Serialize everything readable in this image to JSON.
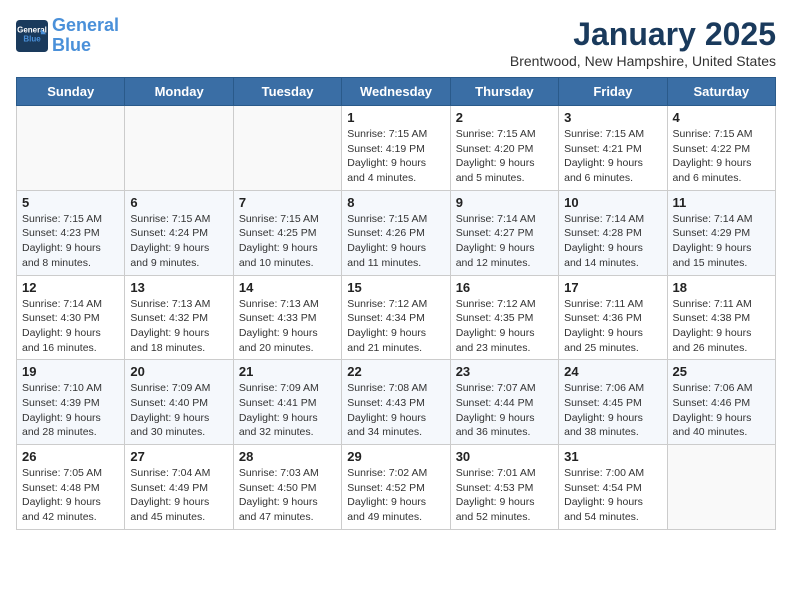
{
  "header": {
    "logo_line1": "General",
    "logo_line2": "Blue",
    "month": "January 2025",
    "location": "Brentwood, New Hampshire, United States"
  },
  "weekdays": [
    "Sunday",
    "Monday",
    "Tuesday",
    "Wednesday",
    "Thursday",
    "Friday",
    "Saturday"
  ],
  "weeks": [
    [
      {
        "day": "",
        "info": ""
      },
      {
        "day": "",
        "info": ""
      },
      {
        "day": "",
        "info": ""
      },
      {
        "day": "1",
        "info": "Sunrise: 7:15 AM\nSunset: 4:19 PM\nDaylight: 9 hours and 4 minutes."
      },
      {
        "day": "2",
        "info": "Sunrise: 7:15 AM\nSunset: 4:20 PM\nDaylight: 9 hours and 5 minutes."
      },
      {
        "day": "3",
        "info": "Sunrise: 7:15 AM\nSunset: 4:21 PM\nDaylight: 9 hours and 6 minutes."
      },
      {
        "day": "4",
        "info": "Sunrise: 7:15 AM\nSunset: 4:22 PM\nDaylight: 9 hours and 6 minutes."
      }
    ],
    [
      {
        "day": "5",
        "info": "Sunrise: 7:15 AM\nSunset: 4:23 PM\nDaylight: 9 hours and 8 minutes."
      },
      {
        "day": "6",
        "info": "Sunrise: 7:15 AM\nSunset: 4:24 PM\nDaylight: 9 hours and 9 minutes."
      },
      {
        "day": "7",
        "info": "Sunrise: 7:15 AM\nSunset: 4:25 PM\nDaylight: 9 hours and 10 minutes."
      },
      {
        "day": "8",
        "info": "Sunrise: 7:15 AM\nSunset: 4:26 PM\nDaylight: 9 hours and 11 minutes."
      },
      {
        "day": "9",
        "info": "Sunrise: 7:14 AM\nSunset: 4:27 PM\nDaylight: 9 hours and 12 minutes."
      },
      {
        "day": "10",
        "info": "Sunrise: 7:14 AM\nSunset: 4:28 PM\nDaylight: 9 hours and 14 minutes."
      },
      {
        "day": "11",
        "info": "Sunrise: 7:14 AM\nSunset: 4:29 PM\nDaylight: 9 hours and 15 minutes."
      }
    ],
    [
      {
        "day": "12",
        "info": "Sunrise: 7:14 AM\nSunset: 4:30 PM\nDaylight: 9 hours and 16 minutes."
      },
      {
        "day": "13",
        "info": "Sunrise: 7:13 AM\nSunset: 4:32 PM\nDaylight: 9 hours and 18 minutes."
      },
      {
        "day": "14",
        "info": "Sunrise: 7:13 AM\nSunset: 4:33 PM\nDaylight: 9 hours and 20 minutes."
      },
      {
        "day": "15",
        "info": "Sunrise: 7:12 AM\nSunset: 4:34 PM\nDaylight: 9 hours and 21 minutes."
      },
      {
        "day": "16",
        "info": "Sunrise: 7:12 AM\nSunset: 4:35 PM\nDaylight: 9 hours and 23 minutes."
      },
      {
        "day": "17",
        "info": "Sunrise: 7:11 AM\nSunset: 4:36 PM\nDaylight: 9 hours and 25 minutes."
      },
      {
        "day": "18",
        "info": "Sunrise: 7:11 AM\nSunset: 4:38 PM\nDaylight: 9 hours and 26 minutes."
      }
    ],
    [
      {
        "day": "19",
        "info": "Sunrise: 7:10 AM\nSunset: 4:39 PM\nDaylight: 9 hours and 28 minutes."
      },
      {
        "day": "20",
        "info": "Sunrise: 7:09 AM\nSunset: 4:40 PM\nDaylight: 9 hours and 30 minutes."
      },
      {
        "day": "21",
        "info": "Sunrise: 7:09 AM\nSunset: 4:41 PM\nDaylight: 9 hours and 32 minutes."
      },
      {
        "day": "22",
        "info": "Sunrise: 7:08 AM\nSunset: 4:43 PM\nDaylight: 9 hours and 34 minutes."
      },
      {
        "day": "23",
        "info": "Sunrise: 7:07 AM\nSunset: 4:44 PM\nDaylight: 9 hours and 36 minutes."
      },
      {
        "day": "24",
        "info": "Sunrise: 7:06 AM\nSunset: 4:45 PM\nDaylight: 9 hours and 38 minutes."
      },
      {
        "day": "25",
        "info": "Sunrise: 7:06 AM\nSunset: 4:46 PM\nDaylight: 9 hours and 40 minutes."
      }
    ],
    [
      {
        "day": "26",
        "info": "Sunrise: 7:05 AM\nSunset: 4:48 PM\nDaylight: 9 hours and 42 minutes."
      },
      {
        "day": "27",
        "info": "Sunrise: 7:04 AM\nSunset: 4:49 PM\nDaylight: 9 hours and 45 minutes."
      },
      {
        "day": "28",
        "info": "Sunrise: 7:03 AM\nSunset: 4:50 PM\nDaylight: 9 hours and 47 minutes."
      },
      {
        "day": "29",
        "info": "Sunrise: 7:02 AM\nSunset: 4:52 PM\nDaylight: 9 hours and 49 minutes."
      },
      {
        "day": "30",
        "info": "Sunrise: 7:01 AM\nSunset: 4:53 PM\nDaylight: 9 hours and 52 minutes."
      },
      {
        "day": "31",
        "info": "Sunrise: 7:00 AM\nSunset: 4:54 PM\nDaylight: 9 hours and 54 minutes."
      },
      {
        "day": "",
        "info": ""
      }
    ]
  ]
}
